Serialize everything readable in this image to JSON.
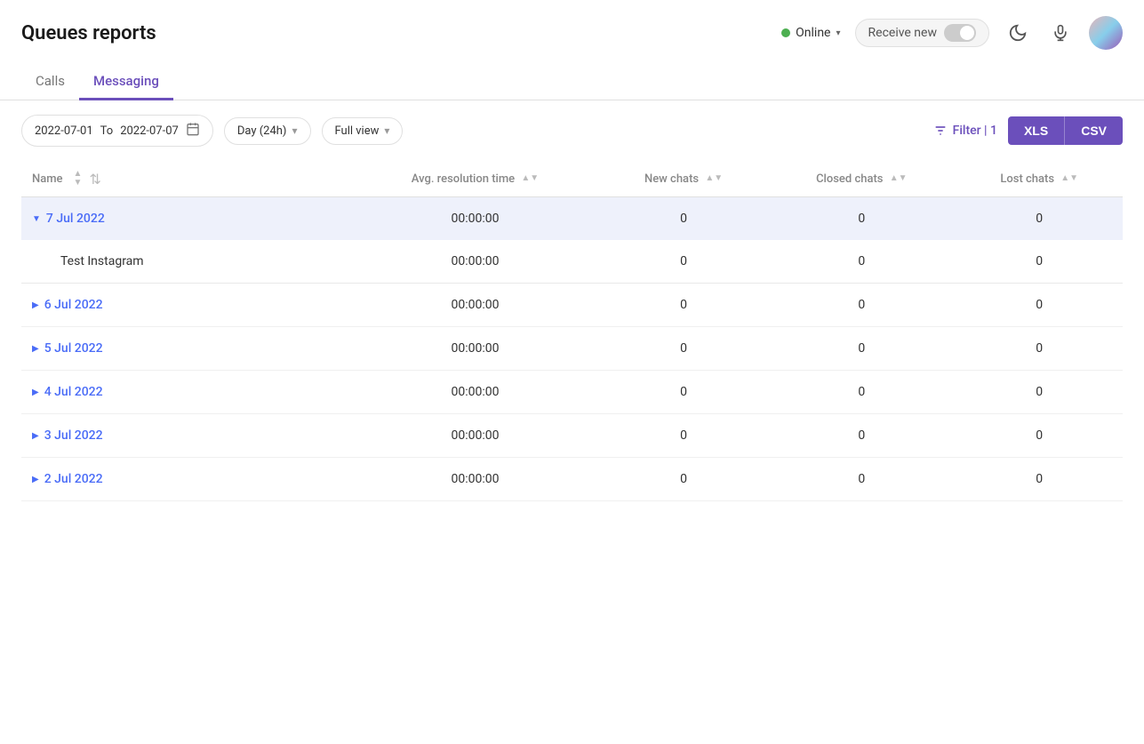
{
  "header": {
    "title": "Queues reports",
    "online_label": "Online",
    "receive_new_label": "Receive new",
    "toggle_state": false
  },
  "tabs": {
    "items": [
      {
        "id": "calls",
        "label": "Calls",
        "active": false
      },
      {
        "id": "messaging",
        "label": "Messaging",
        "active": true
      }
    ]
  },
  "toolbar": {
    "date_from": "2022-07-01",
    "date_separator": "To",
    "date_to": "2022-07-07",
    "period_label": "Day (24h)",
    "view_label": "Full view",
    "filter_label": "Filter | 1",
    "xls_label": "XLS",
    "csv_label": "CSV"
  },
  "table": {
    "columns": [
      {
        "id": "name",
        "label": "Name"
      },
      {
        "id": "avg_resolution_time",
        "label": "Avg. resolution time"
      },
      {
        "id": "new_chats",
        "label": "New chats"
      },
      {
        "id": "closed_chats",
        "label": "Closed chats"
      },
      {
        "id": "lost_chats",
        "label": "Lost chats"
      }
    ],
    "rows": [
      {
        "id": "row-7jul",
        "date": "7 Jul 2022",
        "expanded": true,
        "avg_resolution_time": "00:00:00",
        "new_chats": "0",
        "closed_chats": "0",
        "lost_chats": "0",
        "children": [
          {
            "id": "child-instagram",
            "name": "Test Instagram",
            "avg_resolution_time": "00:00:00",
            "new_chats": "0",
            "closed_chats": "0",
            "lost_chats": "0"
          }
        ]
      },
      {
        "id": "row-6jul",
        "date": "6 Jul 2022",
        "expanded": false,
        "avg_resolution_time": "00:00:00",
        "new_chats": "0",
        "closed_chats": "0",
        "lost_chats": "0",
        "children": []
      },
      {
        "id": "row-5jul",
        "date": "5 Jul 2022",
        "expanded": false,
        "avg_resolution_time": "00:00:00",
        "new_chats": "0",
        "closed_chats": "0",
        "lost_chats": "0",
        "children": []
      },
      {
        "id": "row-4jul",
        "date": "4 Jul 2022",
        "expanded": false,
        "avg_resolution_time": "00:00:00",
        "new_chats": "0",
        "closed_chats": "0",
        "lost_chats": "0",
        "children": []
      },
      {
        "id": "row-3jul",
        "date": "3 Jul 2022",
        "expanded": false,
        "avg_resolution_time": "00:00:00",
        "new_chats": "0",
        "closed_chats": "0",
        "lost_chats": "0",
        "children": []
      },
      {
        "id": "row-2jul",
        "date": "2 Jul 2022",
        "expanded": false,
        "avg_resolution_time": "00:00:00",
        "new_chats": "0",
        "closed_chats": "0",
        "lost_chats": "0",
        "children": []
      }
    ]
  },
  "icons": {
    "online_dot": "●",
    "chevron_down": "▾",
    "calendar": "📅",
    "filter": "≡",
    "sort_up": "▲",
    "sort_down": "▼",
    "expand_right": "▶",
    "expand_down": "▼",
    "col_sort": "⇅",
    "moon": "🌙",
    "mic": "🎙"
  },
  "colors": {
    "accent": "#6b4fbb",
    "link_blue": "#4a6cf7",
    "online_green": "#4caf50",
    "expanded_row_bg": "#eef1fb",
    "border": "#e0e0e0"
  }
}
